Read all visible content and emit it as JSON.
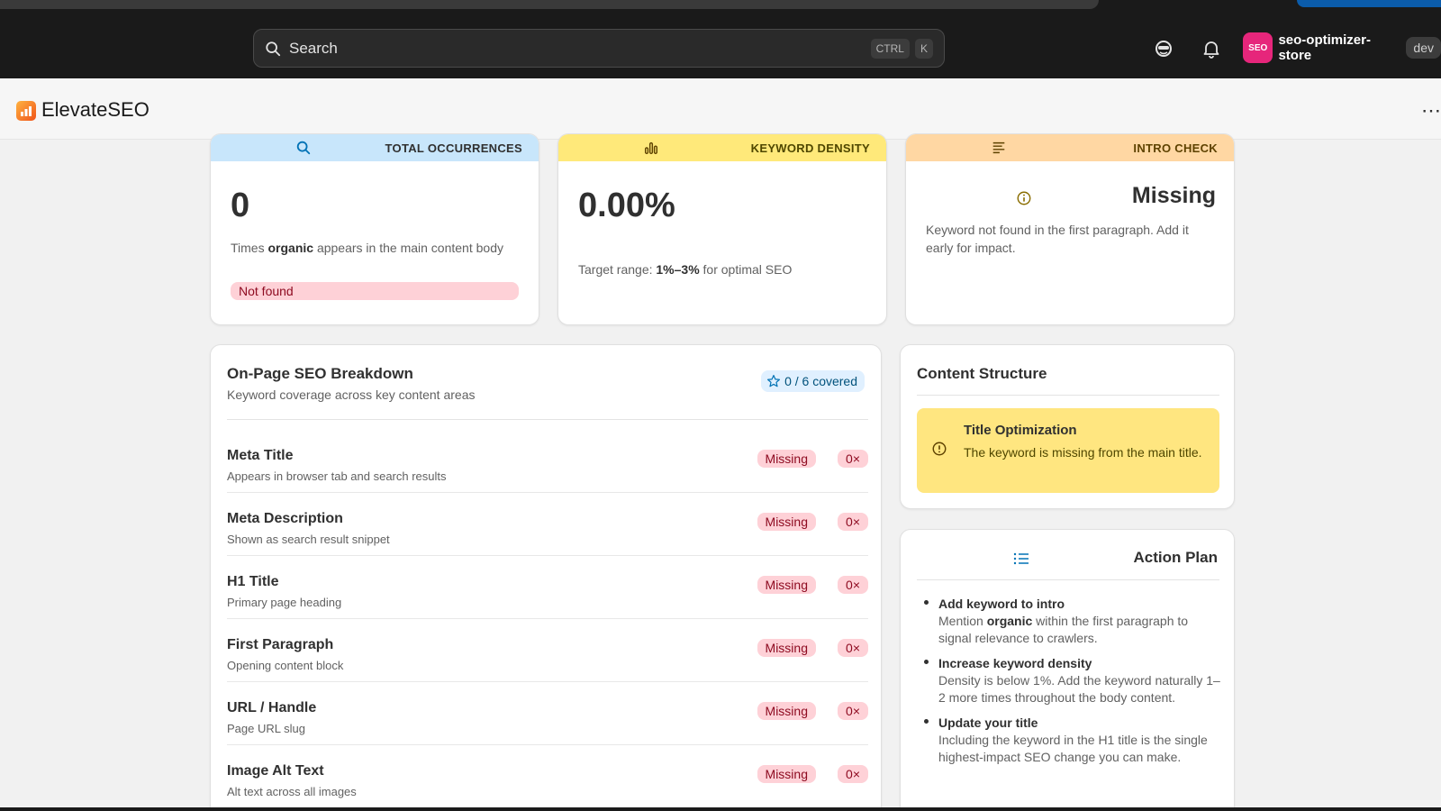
{
  "topbar": {
    "search_placeholder": "Search",
    "kbd_ctrl": "CTRL",
    "kbd_k": "K",
    "store_avatar": "SEO",
    "store_name": "seo-optimizer-store",
    "env_badge": "dev"
  },
  "app": {
    "name": "ElevateSEO",
    "more_icon": "more-horizontal-icon"
  },
  "stats": {
    "occurrences": {
      "label": "TOTAL OCCURRENCES",
      "value": "0",
      "desc_pre": "Times",
      "keyword": "organic",
      "desc_post": "appears in the main content body",
      "status": "Not found",
      "color": "#c8e6fb"
    },
    "density": {
      "label": "KEYWORD DENSITY",
      "value": "0.00%",
      "desc_pre": "Target range:",
      "range": "1%–3%",
      "desc_post": "for optimal SEO",
      "color": "#ffe97a"
    },
    "intro": {
      "label": "INTRO CHECK",
      "value": "Missing",
      "desc": "Keyword not found in the first paragraph. Add it early for impact.",
      "color": "#ffd7a3"
    }
  },
  "breakdown": {
    "title": "On-Page SEO Breakdown",
    "subtitle": "Keyword coverage across key content areas",
    "covered": "0 / 6 covered",
    "rows": [
      {
        "title": "Meta Title",
        "sub": "Appears in browser tab and search results",
        "status": "Missing",
        "count": "0×"
      },
      {
        "title": "Meta Description",
        "sub": "Shown as search result snippet",
        "status": "Missing",
        "count": "0×"
      },
      {
        "title": "H1 Title",
        "sub": "Primary page heading",
        "status": "Missing",
        "count": "0×"
      },
      {
        "title": "First Paragraph",
        "sub": "Opening content block",
        "status": "Missing",
        "count": "0×"
      },
      {
        "title": "URL / Handle",
        "sub": "Page URL slug",
        "status": "Missing",
        "count": "0×"
      },
      {
        "title": "Image Alt Text",
        "sub": "Alt text across all images",
        "status": "Missing",
        "count": "0×"
      }
    ]
  },
  "structure": {
    "title": "Content Structure",
    "alert_title": "Title Optimization",
    "alert_desc": "The keyword is missing from the main title."
  },
  "plan": {
    "title": "Action Plan",
    "items": [
      {
        "title": "Add keyword to intro",
        "desc_pre": "Mention",
        "keyword": "organic",
        "desc_post": "within the first paragraph to signal relevance to crawlers."
      },
      {
        "title": "Increase keyword density",
        "desc": "Density is below 1%. Add the keyword naturally 1–2 more times throughout the body content."
      },
      {
        "title": "Update your title",
        "desc": "Including the keyword in the H1 title is the single highest-impact SEO change you can make."
      }
    ]
  }
}
